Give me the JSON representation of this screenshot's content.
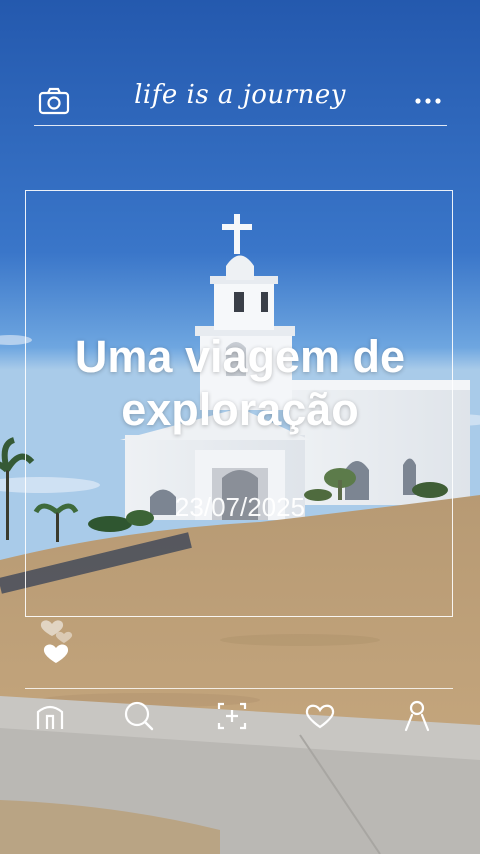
{
  "header": {
    "brand_text": "life is a journey",
    "camera_icon": "camera-icon",
    "more_icon": "more-horizontal-icon"
  },
  "post": {
    "title_line1": "Uma viagem de",
    "title_line2": "exploração",
    "date": "23/07/2025"
  },
  "reactions": {
    "icon": "heart-icon",
    "floating_icon": "floating-heart-icon"
  },
  "tabbar": {
    "items": [
      {
        "icon": "home-icon"
      },
      {
        "icon": "search-icon"
      },
      {
        "icon": "add-icon"
      },
      {
        "icon": "heart-icon"
      },
      {
        "icon": "profile-icon"
      }
    ]
  },
  "colors": {
    "sky_top": "#2c63b8",
    "sky_horizon": "#7fb0e6",
    "ground": "#c0a07a",
    "foreground": "#ffffff"
  }
}
